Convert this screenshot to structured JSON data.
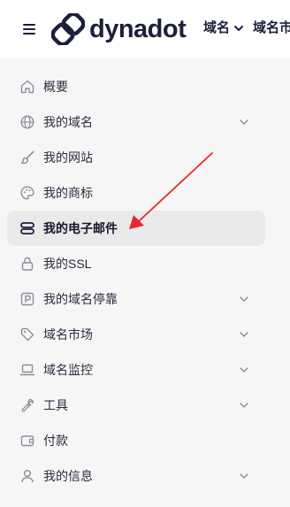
{
  "brand": {
    "name": "dynadot",
    "color": "#1b1f3a"
  },
  "top_nav": {
    "items": [
      {
        "label": "域名",
        "has_dropdown": true
      },
      {
        "label": "域名市"
      }
    ]
  },
  "sidebar": {
    "active_index": 3,
    "items": [
      {
        "label": "概要",
        "icon": "home-icon",
        "expandable": false
      },
      {
        "label": "我的域名",
        "icon": "globe-icon",
        "expandable": true
      },
      {
        "label": "我的网站",
        "icon": "brush-icon",
        "expandable": false
      },
      {
        "label": "我的商标",
        "icon": "palette-icon",
        "expandable": false
      },
      {
        "label": "我的电子邮件",
        "icon": "server-icon",
        "expandable": false
      },
      {
        "label": "我的SSL",
        "icon": "lock-icon",
        "expandable": false
      },
      {
        "label": "我的域名停靠",
        "icon": "parking-icon",
        "expandable": true
      },
      {
        "label": "域名市场",
        "icon": "tag-icon",
        "expandable": true
      },
      {
        "label": "域名监控",
        "icon": "laptop-icon",
        "expandable": true
      },
      {
        "label": "工具",
        "icon": "wrench-icon",
        "expandable": true
      },
      {
        "label": "付款",
        "icon": "wallet-icon",
        "expandable": false
      },
      {
        "label": "我的信息",
        "icon": "user-icon",
        "expandable": true
      }
    ]
  },
  "colors": {
    "sidebar_bg": "#f6f6f7",
    "active_bg": "#eaeaeb",
    "icon": "#8c8f99",
    "annotation_arrow": "#e8262b"
  }
}
